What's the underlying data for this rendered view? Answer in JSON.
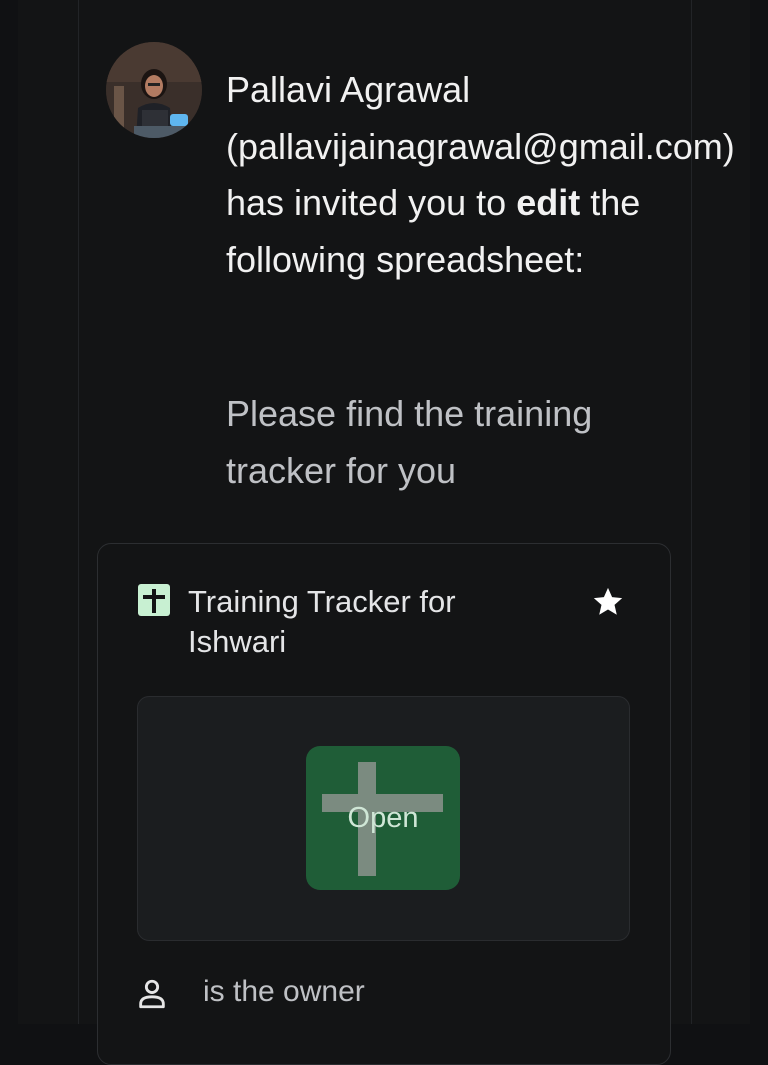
{
  "email": {
    "sender_name": "Pallavi Agrawal",
    "sender_email": "(pallavijainagrawal@gmail.com)",
    "invite_pre": "has invited you to",
    "invite_role": "edit",
    "invite_post": "the following spreadsheet:",
    "message": "Please find the training tracker for you"
  },
  "file": {
    "name": "Training Tracker for Ishwari",
    "open_label": "Open",
    "owner_text": "is the owner",
    "icon": "sheets-icon"
  },
  "icons": {
    "star": "star-icon",
    "owner": "person-icon"
  },
  "colors": {
    "background": "#131415",
    "thumb_green": "#1f5d37",
    "sheets_icon": "#c8f0d2"
  }
}
